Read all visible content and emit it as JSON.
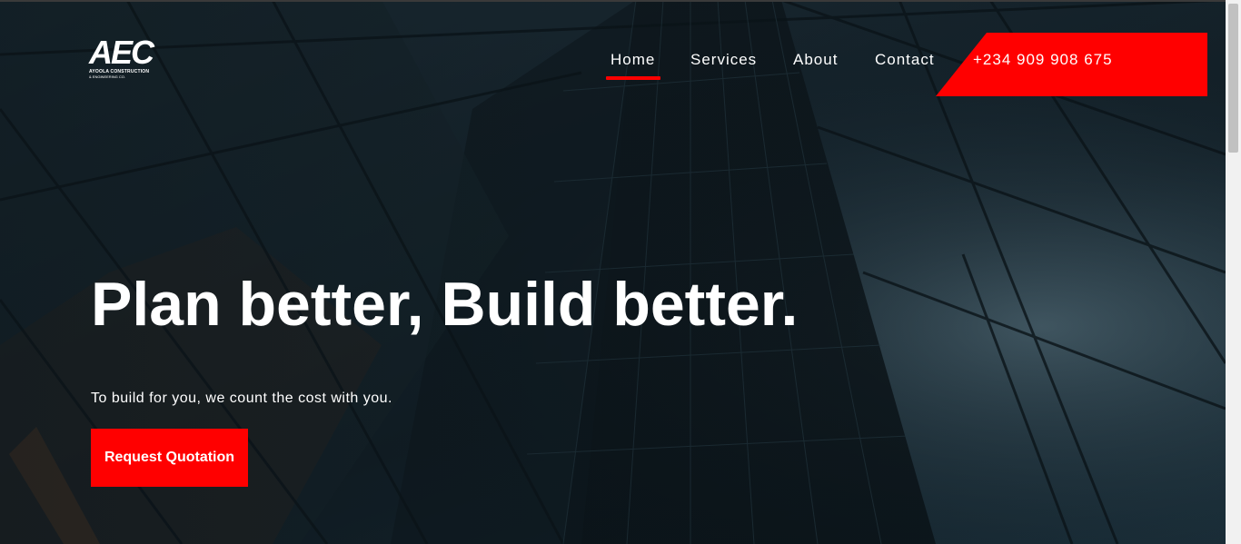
{
  "brand": {
    "logo_mark": "AEC",
    "name": "AYOOLA CONSTRUCTION",
    "sub": "& ENGINEERING CO."
  },
  "nav": {
    "items": [
      {
        "label": "Home",
        "active": true
      },
      {
        "label": "Services",
        "active": false
      },
      {
        "label": "About",
        "active": false
      },
      {
        "label": "Contact",
        "active": false
      }
    ],
    "phone": "+234 909 908 675"
  },
  "hero": {
    "headline": "Plan better, Build better.",
    "subline": "To build for you, we count the cost with you.",
    "cta_label": "Request Quotation"
  },
  "colors": {
    "accent": "#ff0000",
    "text": "#ffffff"
  }
}
